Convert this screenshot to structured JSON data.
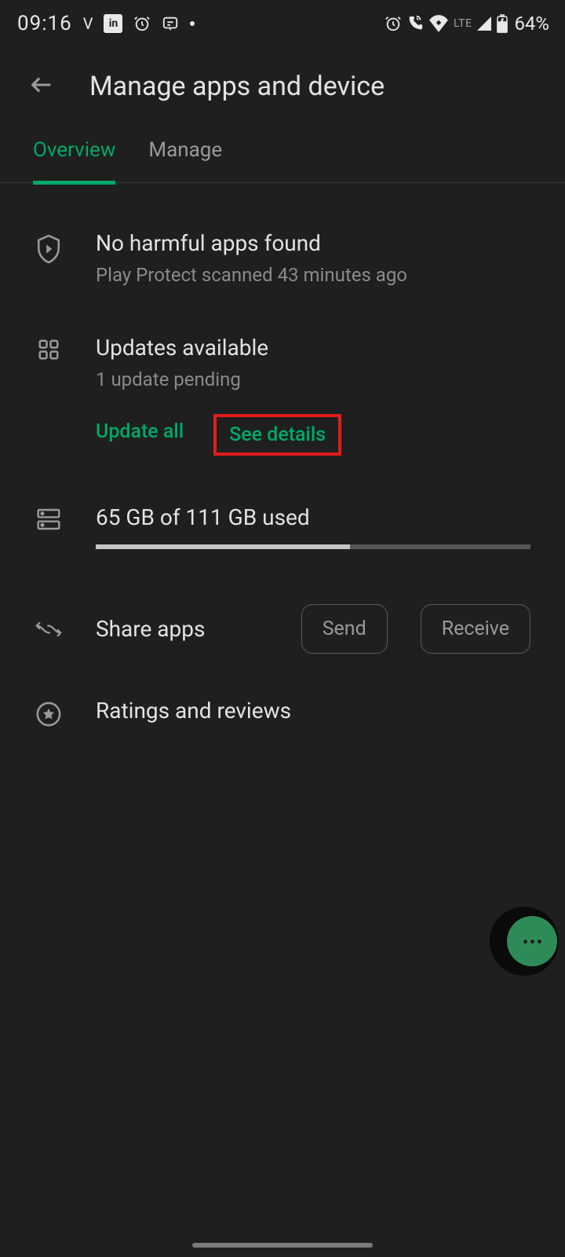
{
  "status_bar": {
    "time": "09:16",
    "v_indicator": "V",
    "lte_label": "LTE",
    "battery_text": "64%"
  },
  "header": {
    "title": "Manage apps and device"
  },
  "tabs": {
    "overview": "Overview",
    "manage": "Manage"
  },
  "play_protect": {
    "title": "No harmful apps found",
    "subtitle": "Play Protect scanned 43 minutes ago"
  },
  "updates": {
    "title": "Updates available",
    "subtitle": "1 update pending",
    "update_all_label": "Update all",
    "see_details_label": "See details"
  },
  "storage": {
    "label": "65 GB of 111 GB used",
    "fill_percent": 58.5
  },
  "share": {
    "label": "Share apps",
    "send_label": "Send",
    "receive_label": "Receive"
  },
  "ratings": {
    "label": "Ratings and reviews"
  }
}
